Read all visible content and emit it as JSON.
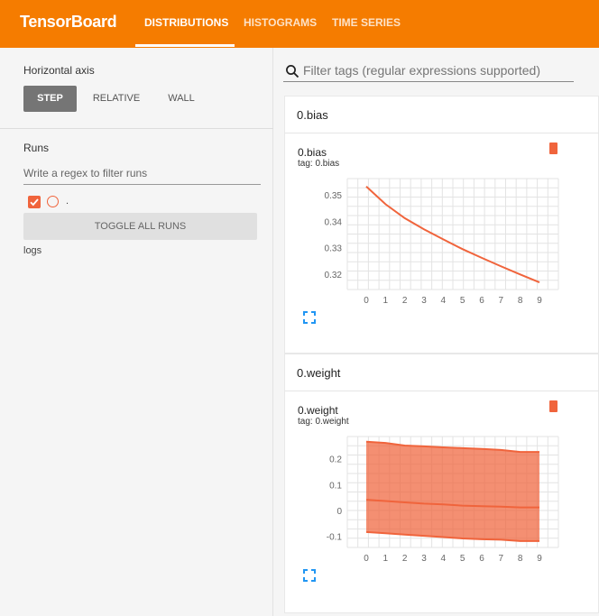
{
  "header": {
    "brand": "TensorBoard",
    "tabs": [
      "DISTRIBUTIONS",
      "HISTOGRAMS",
      "TIME SERIES"
    ],
    "active_tab": "DISTRIBUTIONS"
  },
  "sidebar": {
    "horizontal_axis_label": "Horizontal axis",
    "axis_options": [
      "STEP",
      "RELATIVE",
      "WALL"
    ],
    "selected_axis": "STEP",
    "runs_label": "Runs",
    "regex_placeholder": "Write a regex to filter runs",
    "run_name": ".",
    "toggle_label": "TOGGLE ALL RUNS",
    "logs_label": "logs"
  },
  "main": {
    "filter_placeholder": "Filter tags (regular expressions supported)",
    "groups": [
      {
        "title": "0.bias",
        "card_title": "0.bias",
        "card_tag": "tag: 0.bias"
      },
      {
        "title": "0.weight",
        "card_title": "0.weight",
        "card_tag": "tag: 0.weight"
      }
    ]
  },
  "colors": {
    "accent": "#f57c00",
    "run": "#f0643c"
  },
  "icons": [
    "search-icon",
    "check-icon",
    "expand-icon",
    "color-swatch-icon"
  ],
  "chart_data": [
    {
      "type": "line",
      "x": [
        0,
        1,
        2,
        3,
        4,
        5,
        6,
        7,
        8,
        9
      ],
      "series": [
        {
          "values": [
            0.3535,
            0.3468,
            0.3415,
            0.3373,
            0.3335,
            0.3298,
            0.3265,
            0.3233,
            0.3202,
            0.3172
          ]
        }
      ],
      "xticks": [
        "0",
        "1",
        "2",
        "3",
        "4",
        "5",
        "6",
        "7",
        "8",
        "9"
      ],
      "yticks": [
        "0.35",
        "0.34",
        "0.33",
        "0.32"
      ],
      "ylim": [
        0.3145,
        0.3565
      ],
      "grid": true
    },
    {
      "type": "area",
      "x": [
        0,
        1,
        2,
        3,
        4,
        5,
        6,
        7,
        8,
        9
      ],
      "series": [
        {
          "role": "max",
          "values": [
            0.27,
            0.265,
            0.255,
            0.252,
            0.248,
            0.245,
            0.242,
            0.238,
            0.23,
            0.23
          ]
        },
        {
          "role": "median",
          "values": [
            0.045,
            0.04,
            0.035,
            0.03,
            0.027,
            0.022,
            0.02,
            0.018,
            0.015,
            0.015
          ]
        },
        {
          "role": "min",
          "values": [
            -0.08,
            -0.085,
            -0.09,
            -0.095,
            -0.1,
            -0.105,
            -0.108,
            -0.11,
            -0.115,
            -0.115
          ]
        }
      ],
      "xticks": [
        "0",
        "1",
        "2",
        "3",
        "4",
        "5",
        "6",
        "7",
        "8",
        "9"
      ],
      "yticks": [
        "0.2",
        "0.1",
        "0",
        "-0.1"
      ],
      "ylim": [
        -0.14,
        0.29
      ],
      "grid": true
    }
  ]
}
